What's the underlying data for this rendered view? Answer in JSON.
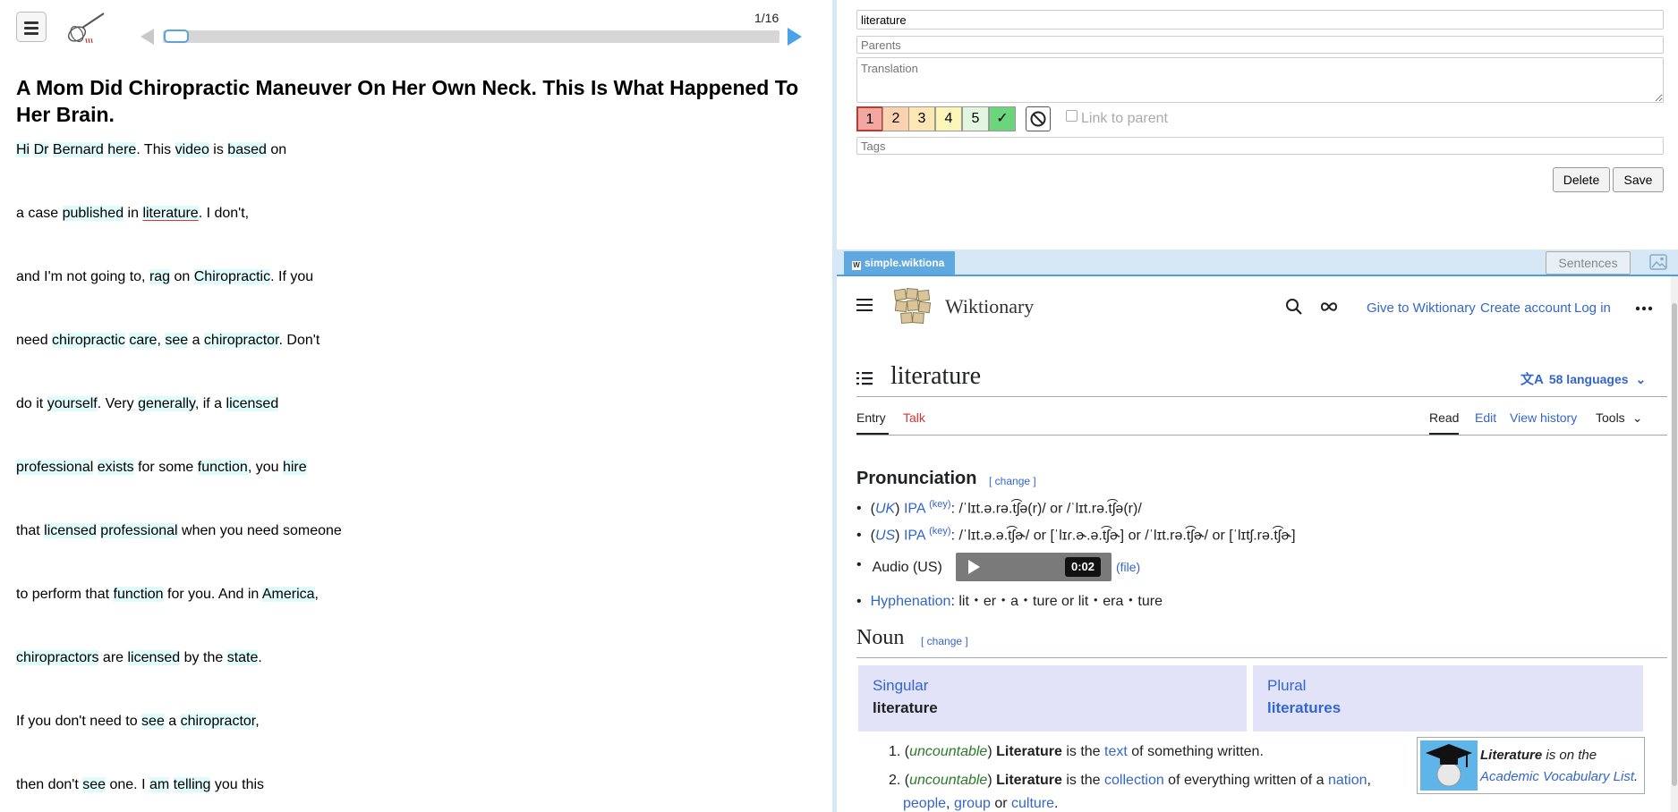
{
  "left": {
    "page_counter": "1/16",
    "title": "A Mom Did Chiropractic Maneuver On Her Own Neck. This Is What Happened To Her Brain.",
    "lines": [
      [
        [
          "Hi",
          1
        ],
        [
          " ",
          0
        ],
        [
          "Dr",
          1
        ],
        [
          " ",
          0
        ],
        [
          "Bernard",
          1
        ],
        [
          " ",
          0
        ],
        [
          "here",
          1
        ],
        [
          ". This ",
          0
        ],
        [
          "video",
          1
        ],
        [
          " is ",
          0
        ],
        [
          "based",
          1
        ],
        [
          " on",
          0
        ]
      ],
      [
        [
          "a case ",
          0
        ],
        [
          "published",
          1
        ],
        [
          " in ",
          0
        ],
        [
          "literature",
          2
        ],
        [
          ". I don't,",
          0
        ]
      ],
      [
        [
          "and I'm not going to, ",
          0
        ],
        [
          "rag",
          1
        ],
        [
          " on ",
          0
        ],
        [
          "Chiropractic",
          1
        ],
        [
          ". If you",
          0
        ]
      ],
      [
        [
          "need ",
          0
        ],
        [
          "chiropractic",
          1
        ],
        [
          " ",
          0
        ],
        [
          "care",
          1
        ],
        [
          ", ",
          0
        ],
        [
          "see",
          1
        ],
        [
          " a ",
          0
        ],
        [
          "chiropractor",
          1
        ],
        [
          ". Don't",
          0
        ]
      ],
      [
        [
          "do it ",
          0
        ],
        [
          "yourself",
          1
        ],
        [
          ". Very ",
          0
        ],
        [
          "generally",
          1
        ],
        [
          ", if a ",
          0
        ],
        [
          "licensed",
          1
        ]
      ],
      [
        [
          "professional",
          1
        ],
        [
          " ",
          0
        ],
        [
          "exists",
          1
        ],
        [
          " for some ",
          0
        ],
        [
          "function",
          1
        ],
        [
          ", you ",
          0
        ],
        [
          "hire",
          1
        ]
      ],
      [
        [
          "that ",
          0
        ],
        [
          "licensed",
          1
        ],
        [
          " ",
          0
        ],
        [
          "professional",
          1
        ],
        [
          " when you need someone",
          0
        ]
      ],
      [
        [
          "to perform that ",
          0
        ],
        [
          "function",
          1
        ],
        [
          " for you. And in ",
          0
        ],
        [
          "America",
          1
        ],
        [
          ",",
          0
        ]
      ],
      [
        [
          "chiropractors",
          1
        ],
        [
          " are ",
          0
        ],
        [
          "licensed",
          1
        ],
        [
          " by the ",
          0
        ],
        [
          "state",
          1
        ],
        [
          ".",
          0
        ]
      ],
      [
        [
          "If you don't need to ",
          0
        ],
        [
          "see",
          1
        ],
        [
          " a ",
          0
        ],
        [
          "chiropractor",
          1
        ],
        [
          ",",
          0
        ]
      ],
      [
        [
          "then don't ",
          0
        ],
        [
          "see",
          1
        ],
        [
          " one. I ",
          0
        ],
        [
          "am",
          1
        ],
        [
          " ",
          0
        ],
        [
          "telling",
          1
        ],
        [
          " you this",
          0
        ]
      ]
    ]
  },
  "editor": {
    "word_value": "literature",
    "parents_placeholder": "Parents",
    "translation_placeholder": "Translation",
    "tags_placeholder": "Tags",
    "grades": [
      {
        "label": "1",
        "color": "#f2a7a0"
      },
      {
        "label": "2",
        "color": "#fbd3b0"
      },
      {
        "label": "3",
        "color": "#fce6b4"
      },
      {
        "label": "4",
        "color": "#fbf6b8"
      },
      {
        "label": "5",
        "color": "#e3f6df"
      },
      {
        "label": "✓",
        "color": "#6cd47b"
      }
    ],
    "link_to_parent_label": "Link to parent",
    "delete_label": "Delete",
    "save_label": "Save"
  },
  "dict_tabs": {
    "active_tab": "simple.wiktiona",
    "sentences_label": "Sentences"
  },
  "wiktionary": {
    "site_name": "Wiktionary",
    "give_link": "Give to Wiktionary",
    "create_account_link": "Create account",
    "login_link": "Log in",
    "page_title": "literature",
    "languages": "58 languages",
    "tab_entry": "Entry",
    "tab_talk": "Talk",
    "tab_read": "Read",
    "tab_edit": "Edit",
    "tab_history": "View history",
    "tab_tools": "Tools",
    "pron_heading": "Pronunciation",
    "change": "[ change ]",
    "uk": {
      "open": "(",
      "region": "UK",
      "close": ")",
      "ipa": "IPA",
      "key": "(key)",
      "text": ": /ˈlɪt.ə.rə.t͡ʃə(r)/ or /ˈlɪt.rə.t͡ʃə(r)/"
    },
    "us": {
      "open": "(",
      "region": "US",
      "close": ")",
      "ipa": "IPA",
      "key": "(key)",
      "text": ": /ˈlɪt.ə.ə.t͡ʃɚ/ or [ˈlɪɾ.ɚ.ə.t͡ʃɚ] or /ˈlɪt.rə.t͡ʃɚ/ or [ˈlɪtʃ.rə.t͡ʃɚ]"
    },
    "audio_label": "Audio (US)",
    "audio_time": "0:02",
    "audio_file": "(file)",
    "hyphenation_label": "Hyphenation",
    "hyphenation_text": ": lit・er・a・ture or lit・era・ture",
    "noun_heading": "Noun",
    "singular_label": "Singular",
    "singular_value": "literature",
    "plural_label": "Plural",
    "plural_value": "literatures",
    "def1": {
      "n": "1.",
      "tag": "uncountable",
      "word": "Literature",
      "text": " is the ",
      "link": "text",
      "rest": " of something written."
    },
    "def2": {
      "n": "2.",
      "tag": "uncountable",
      "word": "Literature",
      "text": " is the ",
      "link": "collection",
      "rest": " of everything written of a ",
      "link2": "nation",
      "comma": ",",
      "link3": "people",
      "comma2": ",",
      "link4": "group",
      "or": " or ",
      "link5": "culture",
      "end": "."
    },
    "avl_word": "Literature",
    "avl_text": " is on the",
    "avl_link": "Academic Vocabulary List",
    "avl_end": "."
  }
}
